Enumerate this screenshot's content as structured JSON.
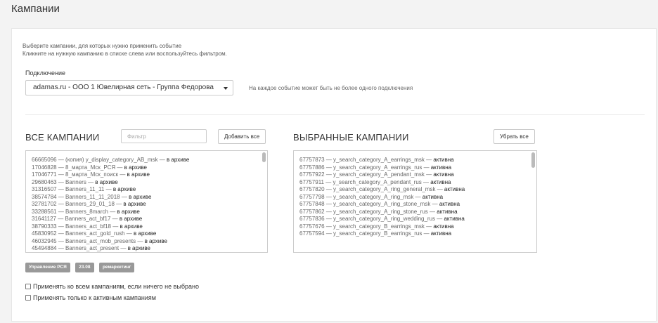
{
  "page": {
    "title": "Кампании"
  },
  "hint": {
    "line1": "Выберите кампании, для которых нужно применить событие",
    "line2": "Кликните на нужную кампанию в списке слева или воспользуйтесь фильтром."
  },
  "connection": {
    "label": "Подключение",
    "value": "adamas.ru - ООО 1 Ювелирная сеть - Группа Федорова",
    "note": "На каждое событие может быть не более одного подключения"
  },
  "all_campaigns": {
    "title": "ВСЕ КАМПАНИИ",
    "filter_placeholder": "Фильтр",
    "add_all_label": "Добавить все",
    "items": [
      {
        "id": "66665096",
        "name": "(копия) y_display_category_AB_msk",
        "status": "в архиве"
      },
      {
        "id": "17046828",
        "name": "8_марта_Мск_РСЯ",
        "status": "в архиве"
      },
      {
        "id": "17046771",
        "name": "8_марта_Мск_поиск",
        "status": "в архиве"
      },
      {
        "id": "29680463",
        "name": "Banners",
        "status": "в архиве"
      },
      {
        "id": "31316507",
        "name": "Banners_11_11",
        "status": "в архиве"
      },
      {
        "id": "38574784",
        "name": "Banners_11_11_2018",
        "status": "в архиве"
      },
      {
        "id": "32781702",
        "name": "Banners_29_01_18",
        "status": "в архиве"
      },
      {
        "id": "33288561",
        "name": "Banners_8march",
        "status": "в архиве"
      },
      {
        "id": "31641127",
        "name": "Banners_act_bf17",
        "status": "в архиве"
      },
      {
        "id": "38790333",
        "name": "Banners_act_bf18",
        "status": "в архиве"
      },
      {
        "id": "45830952",
        "name": "Banners_act_gold_rush",
        "status": "в архиве"
      },
      {
        "id": "46032945",
        "name": "Banners_act_mob_presents",
        "status": "в архиве"
      },
      {
        "id": "45494884",
        "name": "Banners_act_present",
        "status": "в архиве"
      }
    ]
  },
  "selected_campaigns": {
    "title": "ВЫБРАННЫЕ КАМПАНИИ",
    "remove_all_label": "Убрать все",
    "items": [
      {
        "id": "67757873",
        "name": "y_search_category_A_earrings_msk",
        "status": "активна"
      },
      {
        "id": "67757886",
        "name": "y_search_category_A_earrings_rus",
        "status": "активна"
      },
      {
        "id": "67757922",
        "name": "y_search_category_A_pendant_msk",
        "status": "активна"
      },
      {
        "id": "67757911",
        "name": "y_search_category_A_pendant_rus",
        "status": "активна"
      },
      {
        "id": "67757820",
        "name": "y_search_category_A_ring_general_msk",
        "status": "активна"
      },
      {
        "id": "67757798",
        "name": "y_search_category_A_ring_msk",
        "status": "активна"
      },
      {
        "id": "67757848",
        "name": "y_search_category_A_ring_stone_msk",
        "status": "активна"
      },
      {
        "id": "67757862",
        "name": "y_search_category_A_ring_stone_rus",
        "status": "активна"
      },
      {
        "id": "67757836",
        "name": "y_search_category_A_ring_wedding_rus",
        "status": "активна"
      },
      {
        "id": "67757676",
        "name": "y_search_category_B_earrings_msk",
        "status": "активна"
      },
      {
        "id": "67757594",
        "name": "y_search_category_B_earrings_rus",
        "status": "активна"
      }
    ]
  },
  "tags": [
    "Управление РСЯ",
    "23.08",
    "ремаркетинг"
  ],
  "options": {
    "apply_all_label": "Применять ко всем кампаниям, если ничего не выбрано",
    "active_only_label": "Применять только к активным кампаниям"
  },
  "separator": " — "
}
